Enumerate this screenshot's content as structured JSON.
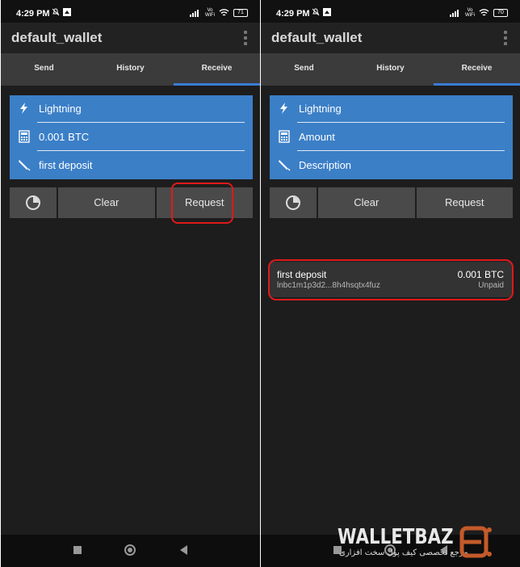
{
  "status_bar": {
    "time": "4:29 PM",
    "battery_left": "71",
    "battery_right": "70",
    "volte": "Vo\nWiFi"
  },
  "left": {
    "app_title": "default_wallet",
    "tabs": [
      {
        "label": "Send"
      },
      {
        "label": "History"
      },
      {
        "label": "Receive"
      }
    ],
    "active_tab": "Receive",
    "form": {
      "type": "Lightning",
      "amount": "0.001 BTC",
      "description": "first deposit"
    },
    "buttons": {
      "clear": "Clear",
      "request": "Request"
    }
  },
  "right": {
    "app_title": "default_wallet",
    "tabs": [
      {
        "label": "Send"
      },
      {
        "label": "History"
      },
      {
        "label": "Receive"
      }
    ],
    "active_tab": "Receive",
    "form": {
      "type": "Lightning",
      "amount_placeholder": "Amount",
      "description_placeholder": "Description"
    },
    "buttons": {
      "clear": "Clear",
      "request": "Request"
    },
    "request_item": {
      "title": "first deposit",
      "invoice": "lnbc1m1p3d2...8h4hsqtx4fuz",
      "amount": "0.001 BTC",
      "status": "Unpaid"
    }
  },
  "watermark": {
    "brand": "WALLETBAZ",
    "tagline": "مرجع تخصصی کیف پول سخت افزاری"
  },
  "colors": {
    "accent": "#3a7bd5",
    "form_bg": "#3b7fc7",
    "highlight": "#e0191b",
    "background": "#1d1d1d"
  },
  "icons": [
    "lightning-icon",
    "calculator-icon",
    "pen-icon",
    "pie-chart-icon",
    "menu-dots-icon"
  ]
}
